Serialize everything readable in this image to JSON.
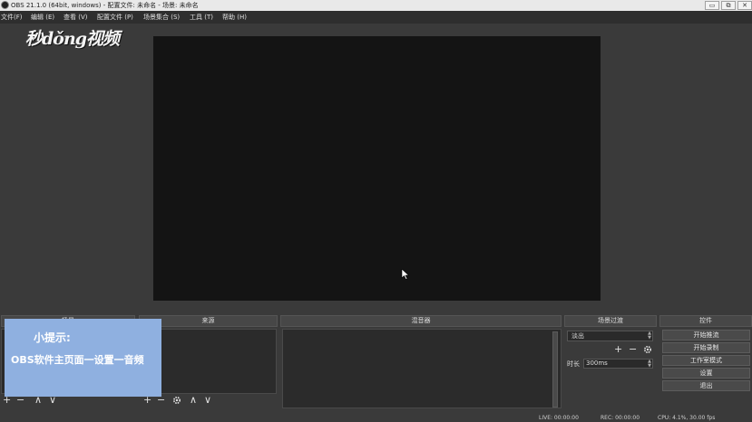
{
  "titlebar": {
    "title": "OBS 21.1.0 (64bit, windows) - 配置文件: 未命名 - 场景: 未命名",
    "minimize": "▭",
    "restore": "⧉",
    "close": "✕"
  },
  "menu": [
    "文件(F)",
    "编辑 (E)",
    "查看 (V)",
    "配置文件 (P)",
    "场景集合 (S)",
    "工具 (T)",
    "帮助 (H)"
  ],
  "watermark": "秒dǒng视频",
  "docks": {
    "scenes": "场景",
    "sources": "来源",
    "mixer": "混音器",
    "transitions": "场景过渡",
    "controls": "控件"
  },
  "toolbar_symbols": {
    "add": "+",
    "remove": "−",
    "up": "∧",
    "down": "∨"
  },
  "transitions": {
    "selected": "淡出",
    "duration_label": "时长",
    "duration_value": "300ms"
  },
  "controls": {
    "start_stream": "开始推流",
    "start_record": "开始录制",
    "studio_mode": "工作室模式",
    "settings": "设置",
    "exit": "退出"
  },
  "status": {
    "live": "LIVE: 00:00:00",
    "rec": "REC: 00:00:00",
    "cpu": "CPU: 4.1%, 30.00 fps"
  },
  "tip": {
    "title": "小提示:",
    "text": "OBS软件主页面一设置一音频"
  },
  "colors": {
    "preview": "#141414",
    "tip_background": "#8fb0e0"
  }
}
